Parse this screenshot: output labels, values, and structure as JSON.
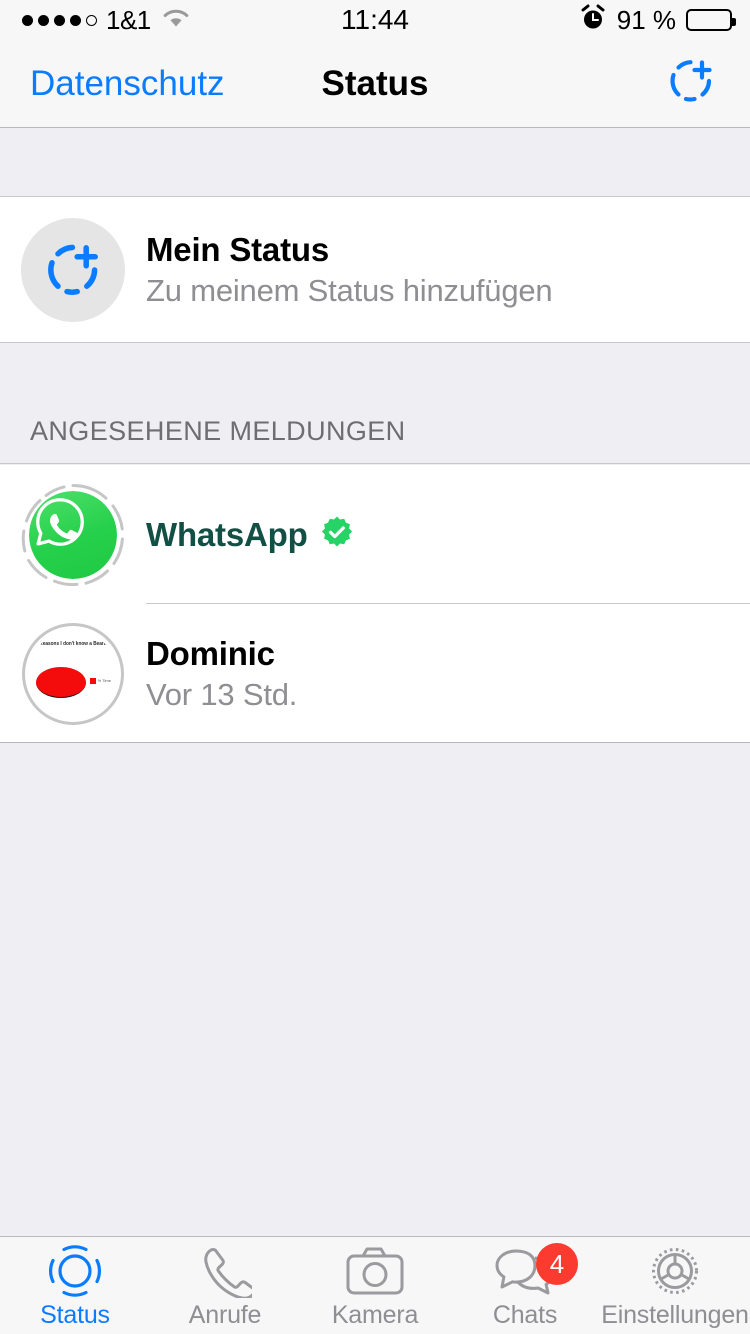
{
  "statusbar": {
    "carrier": "1&1",
    "signal_dots_filled": 4,
    "signal_dots_total": 5,
    "wifi_icon": "wifi-icon",
    "time": "11:44",
    "alarm_icon": "alarm-clock-icon",
    "battery_percent": "91 %",
    "battery_level": 91
  },
  "navbar": {
    "back_label": "Datenschutz",
    "title": "Status",
    "action_icon": "add-status-icon"
  },
  "my_status": {
    "title": "Mein Status",
    "subtitle": "Zu meinem Status hinzufügen",
    "avatar_icon": "add-status-avatar-icon"
  },
  "viewed_section": {
    "header": "ANGESEHENE MELDUNGEN",
    "items": [
      {
        "name": "WhatsApp",
        "verified": true,
        "verified_icon": "verified-badge-icon",
        "avatar_icon": "whatsapp-logo-icon",
        "subtitle": ""
      },
      {
        "name": "Dominic",
        "verified": false,
        "avatar_icon": "pie-chart-thumbnail",
        "subtitle": "Vor 13 Std.",
        "thumb_title": "Reasons I don't know a Beard",
        "thumb_legend": "% Time"
      }
    ]
  },
  "tabbar": {
    "tabs": [
      {
        "label": "Status",
        "icon": "status-rings-icon",
        "active": true,
        "badge": ""
      },
      {
        "label": "Anrufe",
        "icon": "phone-icon",
        "active": false,
        "badge": ""
      },
      {
        "label": "Kamera",
        "icon": "camera-icon",
        "active": false,
        "badge": ""
      },
      {
        "label": "Chats",
        "icon": "chat-bubbles-icon",
        "active": false,
        "badge": "4"
      },
      {
        "label": "Einstellungen",
        "icon": "gear-icon",
        "active": false,
        "badge": ""
      }
    ]
  },
  "colors": {
    "accent_blue": "#0a7cff",
    "whatsapp_green": "#25d04b",
    "badge_red": "#fb3b30",
    "grouped_bg": "#efeef3",
    "secondary_text": "#8e8e93",
    "whatsapp_name_teal": "#124f44"
  }
}
